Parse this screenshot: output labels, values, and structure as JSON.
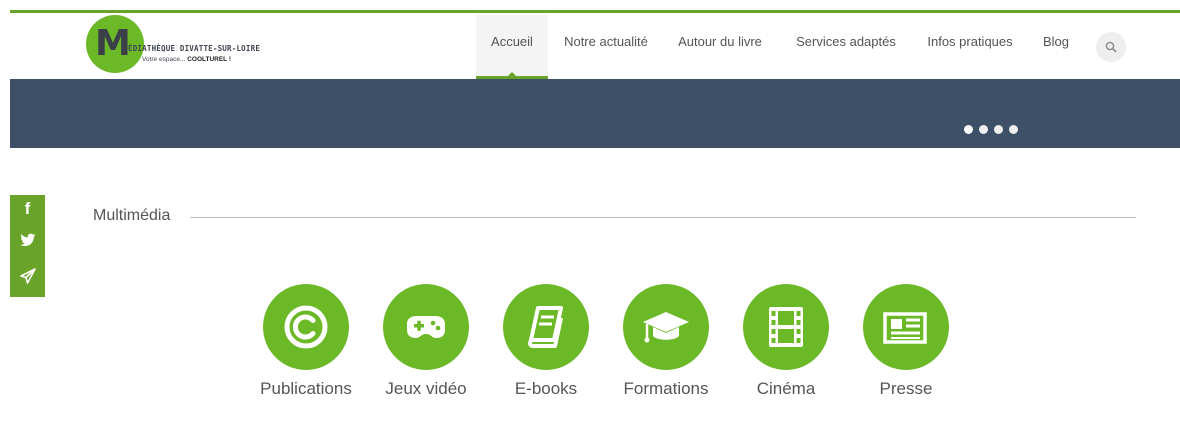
{
  "brand": {
    "letter": "M",
    "name": "ÉDIATHÈQUE DIVATTE-SUR-LOIRE",
    "tagline_prefix": "Votre espace...",
    "tagline_bold": "COOLTUREL !"
  },
  "nav": {
    "items": [
      {
        "label": "Accueil",
        "active": true
      },
      {
        "label": "Notre actualité"
      },
      {
        "label": "Autour du livre"
      },
      {
        "label": "Services adaptés"
      },
      {
        "label": "Infos pratiques"
      },
      {
        "label": "Blog"
      }
    ],
    "search_icon": "search-icon"
  },
  "hero": {
    "slides": 4,
    "active_slide": 1,
    "background": "#3d5068"
  },
  "social": {
    "icons": [
      "facebook-icon",
      "twitter-icon",
      "paper-plane-icon"
    ],
    "labels": [
      "f",
      "",
      ""
    ]
  },
  "section": {
    "title": "Multimédia",
    "tiles": [
      {
        "label": "Publications",
        "icon": "copyright-icon"
      },
      {
        "label": "Jeux vidéo",
        "icon": "gamepad-icon"
      },
      {
        "label": "E-books",
        "icon": "book-icon"
      },
      {
        "label": "Formations",
        "icon": "graduation-cap-icon"
      },
      {
        "label": "Cinéma",
        "icon": "film-icon"
      },
      {
        "label": "Presse",
        "icon": "newspaper-icon"
      }
    ]
  },
  "colors": {
    "accent": "#6aa329",
    "circle": "#6cb928",
    "hero": "#3d5068",
    "text": "#555555"
  }
}
